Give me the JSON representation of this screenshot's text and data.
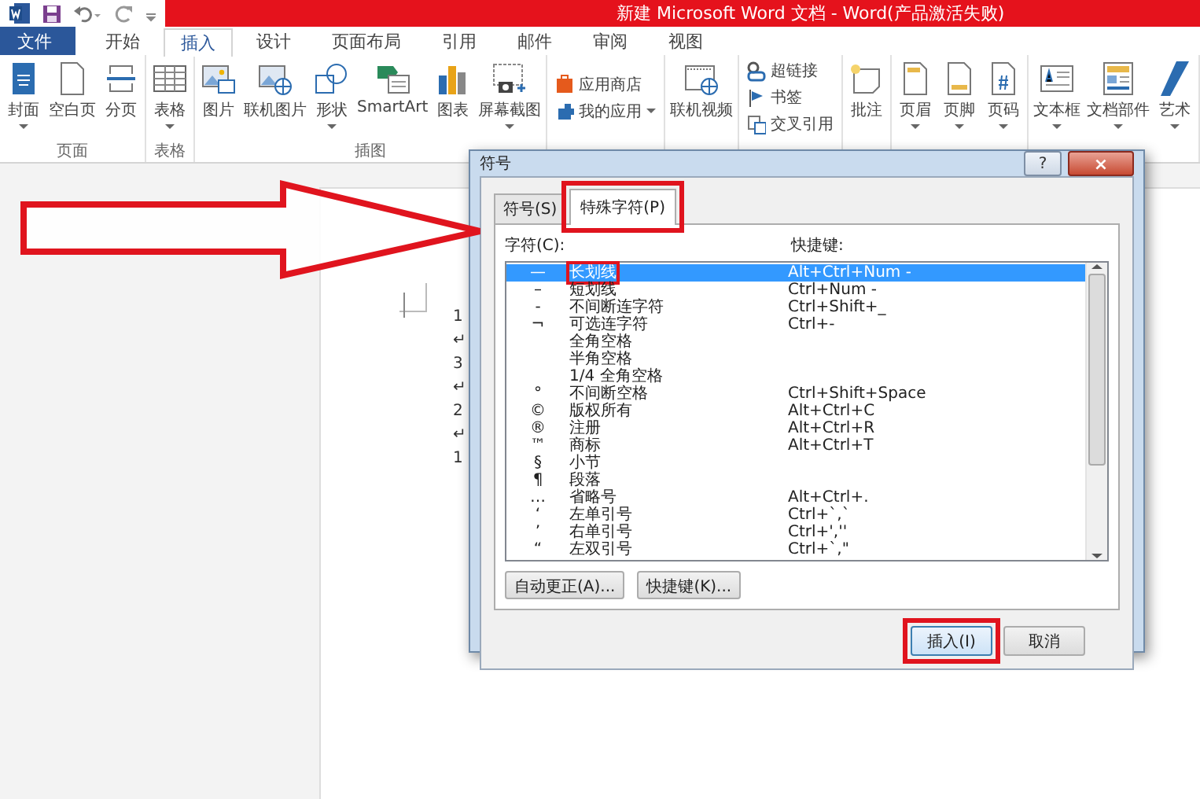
{
  "window": {
    "title": "新建 Microsoft Word 文档 -  Word(产品激活失败)"
  },
  "ribbon_tabs": [
    {
      "label": "文件",
      "kind": "file",
      "selected": false
    },
    {
      "label": "开始",
      "kind": "tab",
      "selected": false
    },
    {
      "label": "插入",
      "kind": "tab",
      "selected": true
    },
    {
      "label": "设计",
      "kind": "tab",
      "selected": false
    },
    {
      "label": "页面布局",
      "kind": "tab",
      "selected": false
    },
    {
      "label": "引用",
      "kind": "tab",
      "selected": false
    },
    {
      "label": "邮件",
      "kind": "tab",
      "selected": false
    },
    {
      "label": "审阅",
      "kind": "tab",
      "selected": false
    },
    {
      "label": "视图",
      "kind": "tab",
      "selected": false
    }
  ],
  "ribbon_groups": [
    {
      "label": "页面",
      "items": [
        {
          "kind": "large",
          "label": "封面",
          "dropdown": true
        },
        {
          "kind": "large",
          "label": "空白页",
          "dropdown": false
        },
        {
          "kind": "large",
          "label": "分页",
          "dropdown": false
        }
      ]
    },
    {
      "label": "表格",
      "items": [
        {
          "kind": "large",
          "label": "表格",
          "dropdown": true
        }
      ]
    },
    {
      "label": "插图",
      "items": [
        {
          "kind": "large",
          "label": "图片",
          "dropdown": false
        },
        {
          "kind": "large",
          "label": "联机图片",
          "dropdown": false
        },
        {
          "kind": "large",
          "label": "形状",
          "dropdown": true
        },
        {
          "kind": "large",
          "label": "SmartArt",
          "dropdown": false
        },
        {
          "kind": "large",
          "label": "图表",
          "dropdown": false
        },
        {
          "kind": "large",
          "label": "屏幕截图",
          "dropdown": true
        }
      ]
    },
    {
      "items": [
        {
          "kind": "small",
          "label": "应用商店",
          "dropdown": false
        },
        {
          "kind": "small",
          "label": "我的应用",
          "dropdown": true
        }
      ]
    },
    {
      "items": [
        {
          "kind": "large",
          "label": "联机视频",
          "dropdown": false
        }
      ]
    },
    {
      "items": [
        {
          "kind": "small",
          "label": "超链接",
          "dropdown": false
        },
        {
          "kind": "small",
          "label": "书签",
          "dropdown": false
        },
        {
          "kind": "small",
          "label": "交叉引用",
          "dropdown": false
        }
      ]
    },
    {
      "items": [
        {
          "kind": "large",
          "label": "批注",
          "dropdown": false
        }
      ]
    },
    {
      "items": [
        {
          "kind": "large",
          "label": "页眉",
          "dropdown": true
        },
        {
          "kind": "large",
          "label": "页脚",
          "dropdown": true
        },
        {
          "kind": "large",
          "label": "页码",
          "dropdown": true
        }
      ]
    },
    {
      "items": [
        {
          "kind": "large",
          "label": "文本框",
          "dropdown": true
        },
        {
          "kind": "large",
          "label": "文档部件",
          "dropdown": true
        },
        {
          "kind": "large",
          "label": "艺术",
          "dropdown": true
        }
      ]
    }
  ],
  "document": {
    "lines": [
      "1",
      "↵",
      "3",
      "↵",
      "2",
      "↵",
      "1"
    ]
  },
  "dialog": {
    "title": "符号",
    "help": "?",
    "close": "×",
    "tabs": [
      {
        "label": "符号(S)",
        "selected": false,
        "highlighted": false
      },
      {
        "label": "特殊字符(P)",
        "selected": true,
        "highlighted": true
      }
    ],
    "list_label": "字符(C):",
    "shortcut_label": "快捷键:",
    "rows": [
      {
        "symbol": "—",
        "name": "长划线",
        "shortcut": "Alt+Ctrl+Num -",
        "selected": true,
        "highlighted": true
      },
      {
        "symbol": "–",
        "name": "短划线",
        "shortcut": "Ctrl+Num -",
        "selected": false,
        "highlighted": false
      },
      {
        "symbol": "-",
        "name": "不间断连字符",
        "shortcut": "Ctrl+Shift+_",
        "selected": false,
        "highlighted": false
      },
      {
        "symbol": "¬",
        "name": "可选连字符",
        "shortcut": "Ctrl+-",
        "selected": false,
        "highlighted": false
      },
      {
        "name": "全角空格",
        "selected": false,
        "highlighted": false
      },
      {
        "name": "半角空格",
        "selected": false,
        "highlighted": false
      },
      {
        "name": "1/4 全角空格",
        "selected": false,
        "highlighted": false
      },
      {
        "symbol": "°",
        "name": "不间断空格",
        "shortcut": "Ctrl+Shift+Space",
        "selected": false,
        "highlighted": false
      },
      {
        "symbol": "©",
        "name": "版权所有",
        "shortcut": "Alt+Ctrl+C",
        "selected": false,
        "highlighted": false
      },
      {
        "symbol": "®",
        "name": "注册",
        "shortcut": "Alt+Ctrl+R",
        "selected": false,
        "highlighted": false
      },
      {
        "symbol": "™",
        "name": "商标",
        "shortcut": "Alt+Ctrl+T",
        "selected": false,
        "highlighted": false
      },
      {
        "symbol": "§",
        "name": "小节",
        "selected": false,
        "highlighted": false
      },
      {
        "symbol": "¶",
        "name": "段落",
        "selected": false,
        "highlighted": false
      },
      {
        "symbol": "…",
        "name": "省略号",
        "shortcut": "Alt+Ctrl+.",
        "selected": false,
        "highlighted": false
      },
      {
        "symbol": "‘",
        "name": "左单引号",
        "shortcut": "Ctrl+`,`",
        "selected": false,
        "highlighted": false
      },
      {
        "symbol": "’",
        "name": "右单引号",
        "shortcut": "Ctrl+',''",
        "selected": false,
        "highlighted": false
      },
      {
        "symbol": "“",
        "name": "左双引号",
        "shortcut": "Ctrl+`,\"",
        "selected": false,
        "highlighted": false
      }
    ],
    "option_buttons": [
      {
        "label": "自动更正(A)...",
        "highlighted": false
      },
      {
        "label": "快捷键(K)...",
        "highlighted": false
      }
    ],
    "footer_buttons": [
      {
        "label": "插入(I)",
        "kind": "default",
        "highlighted": true
      },
      {
        "label": "取消",
        "kind": "normal",
        "highlighted": false
      }
    ]
  }
}
